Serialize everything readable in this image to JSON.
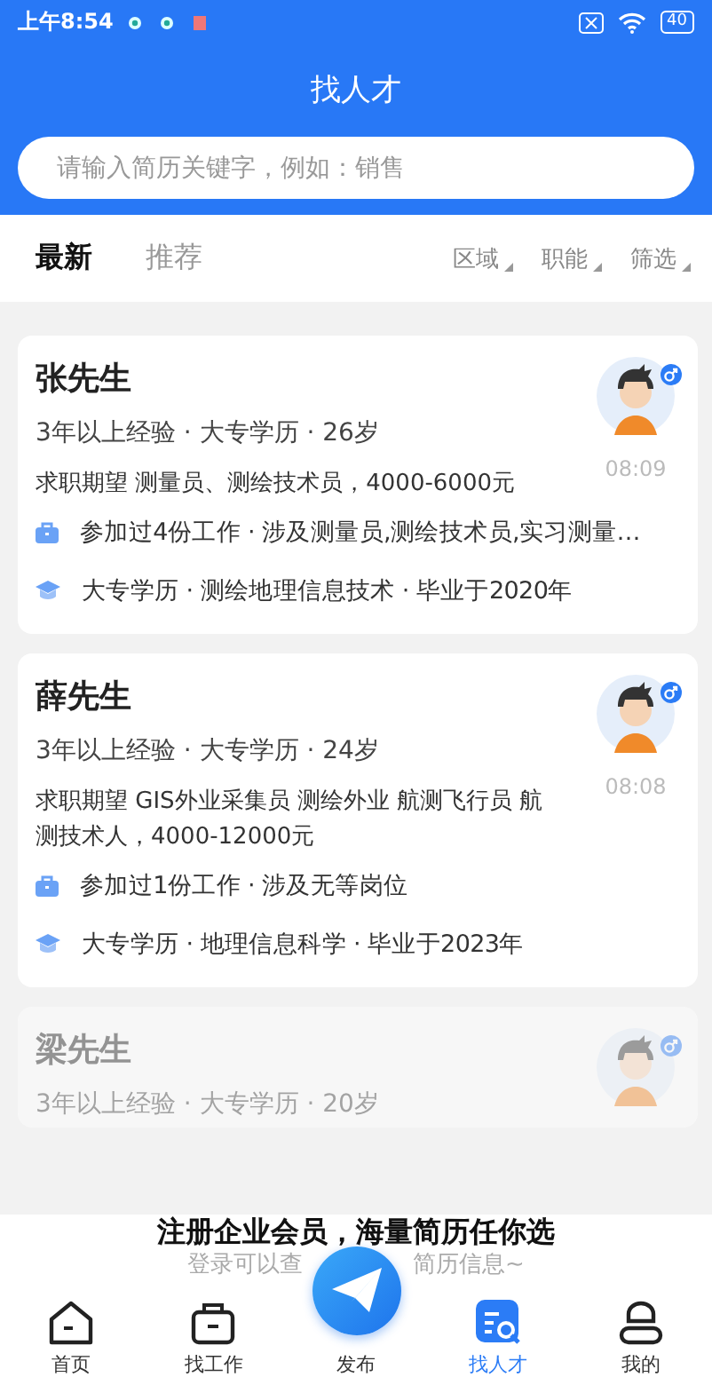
{
  "status_bar": {
    "time": "上午8:54",
    "battery": "40"
  },
  "header": {
    "title": "找人才"
  },
  "search": {
    "placeholder": "请输入简历关键字，例如：销售"
  },
  "tabs": [
    {
      "label": "最新",
      "selected": true
    },
    {
      "label": "推荐",
      "selected": false
    }
  ],
  "filters": [
    "区域",
    "职能",
    "筛选"
  ],
  "candidates": [
    {
      "name": "张先生",
      "summary": "3年以上经验 · 大专学历 · 26岁",
      "expectation": "求职期望 测量员、测绘技术员，4000-6000元",
      "time": "08:09",
      "work": "参加过4份工作 · 涉及测量员,测绘技术员,实习测量…",
      "education": "大专学历 · 测绘地理信息技术 · 毕业于2020年",
      "faded": false
    },
    {
      "name": "薛先生",
      "summary": "3年以上经验 · 大专学历 · 24岁",
      "expectation": "求职期望 GIS外业采集员 测绘外业 航测飞行员 航测技术人，4000-12000元",
      "time": "08:08",
      "work": "参加过1份工作 · 涉及无等岗位",
      "education": "大专学历 · 地理信息科学 · 毕业于2023年",
      "faded": false
    },
    {
      "name": "梁先生",
      "summary": "3年以上经验 · 大专学历 · 20岁",
      "faded": true
    }
  ],
  "promo": {
    "title": "注册企业会员，海量简历任你选",
    "subtitle_parts": [
      "登录可以查",
      "简历信息~"
    ]
  },
  "nav": [
    {
      "label": "首页",
      "kind": "home",
      "selected": false
    },
    {
      "label": "找工作",
      "kind": "jobs",
      "selected": false
    },
    {
      "label": "发布",
      "kind": "publish",
      "selected": false
    },
    {
      "label": "找人才",
      "kind": "talent",
      "selected": true
    },
    {
      "label": "我的",
      "kind": "me",
      "selected": false
    }
  ]
}
